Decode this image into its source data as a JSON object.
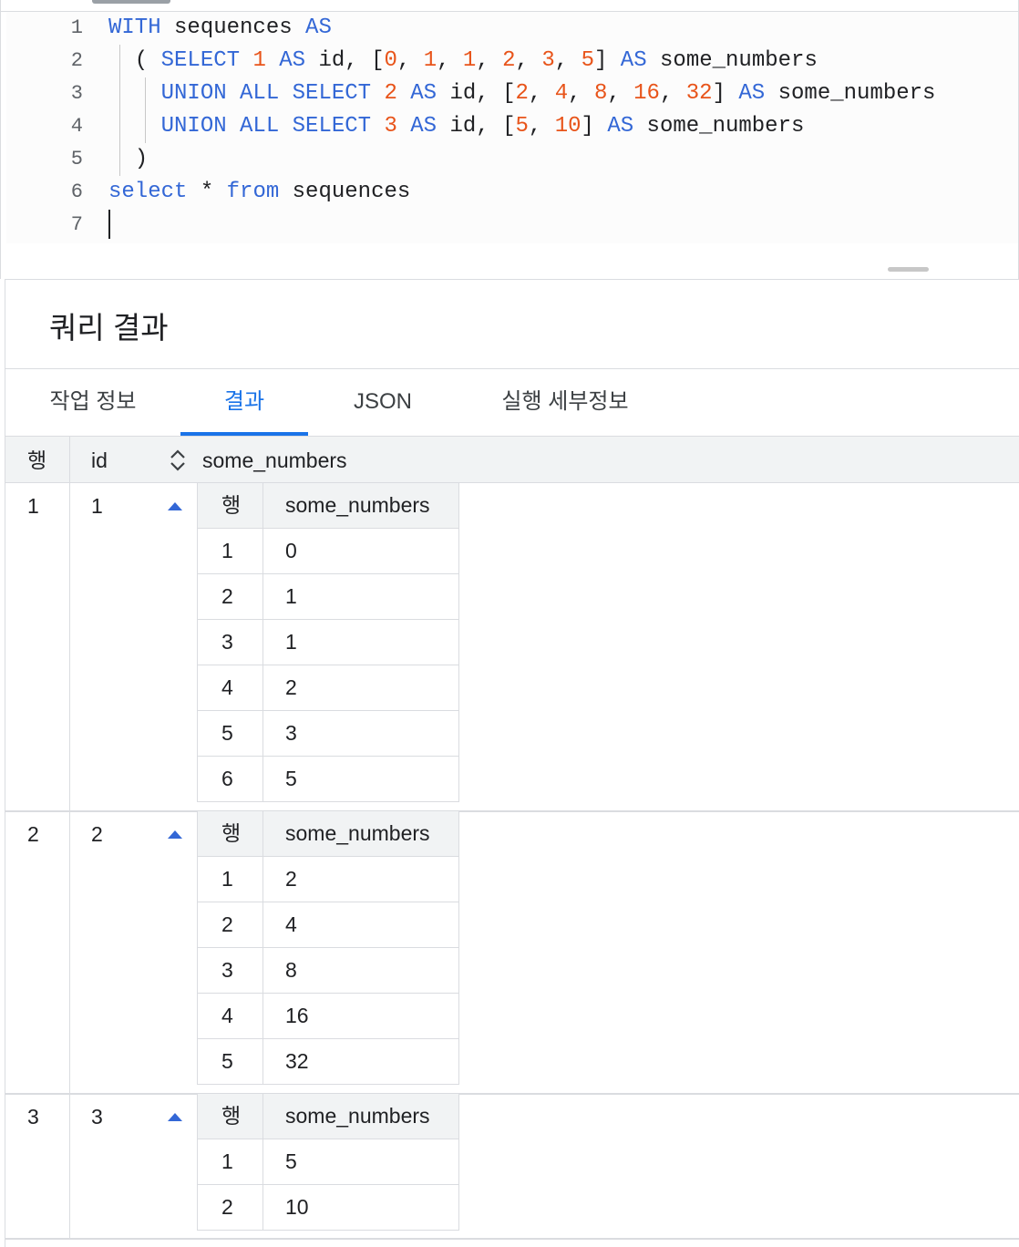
{
  "editor": {
    "lines": [
      {
        "n": "1",
        "tokens": [
          {
            "t": "WITH",
            "c": "kw"
          },
          {
            "t": " sequences ",
            "c": ""
          },
          {
            "t": "AS",
            "c": "kw"
          }
        ]
      },
      {
        "n": "2",
        "tokens": [
          {
            "t": "  ( ",
            "c": ""
          },
          {
            "t": "SELECT",
            "c": "kw"
          },
          {
            "t": " ",
            "c": ""
          },
          {
            "t": "1",
            "c": "num"
          },
          {
            "t": " ",
            "c": ""
          },
          {
            "t": "AS",
            "c": "kw"
          },
          {
            "t": " id, [",
            "c": ""
          },
          {
            "t": "0",
            "c": "num"
          },
          {
            "t": ", ",
            "c": ""
          },
          {
            "t": "1",
            "c": "num"
          },
          {
            "t": ", ",
            "c": ""
          },
          {
            "t": "1",
            "c": "num"
          },
          {
            "t": ", ",
            "c": ""
          },
          {
            "t": "2",
            "c": "num"
          },
          {
            "t": ", ",
            "c": ""
          },
          {
            "t": "3",
            "c": "num"
          },
          {
            "t": ", ",
            "c": ""
          },
          {
            "t": "5",
            "c": "num"
          },
          {
            "t": "] ",
            "c": ""
          },
          {
            "t": "AS",
            "c": "kw"
          },
          {
            "t": " some_numbers",
            "c": ""
          }
        ]
      },
      {
        "n": "3",
        "tokens": [
          {
            "t": "    ",
            "c": ""
          },
          {
            "t": "UNION ALL SELECT",
            "c": "kw"
          },
          {
            "t": " ",
            "c": ""
          },
          {
            "t": "2",
            "c": "num"
          },
          {
            "t": " ",
            "c": ""
          },
          {
            "t": "AS",
            "c": "kw"
          },
          {
            "t": " id, [",
            "c": ""
          },
          {
            "t": "2",
            "c": "num"
          },
          {
            "t": ", ",
            "c": ""
          },
          {
            "t": "4",
            "c": "num"
          },
          {
            "t": ", ",
            "c": ""
          },
          {
            "t": "8",
            "c": "num"
          },
          {
            "t": ", ",
            "c": ""
          },
          {
            "t": "16",
            "c": "num"
          },
          {
            "t": ", ",
            "c": ""
          },
          {
            "t": "32",
            "c": "num"
          },
          {
            "t": "] ",
            "c": ""
          },
          {
            "t": "AS",
            "c": "kw"
          },
          {
            "t": " some_numbers",
            "c": ""
          }
        ]
      },
      {
        "n": "4",
        "tokens": [
          {
            "t": "    ",
            "c": ""
          },
          {
            "t": "UNION ALL SELECT",
            "c": "kw"
          },
          {
            "t": " ",
            "c": ""
          },
          {
            "t": "3",
            "c": "num"
          },
          {
            "t": " ",
            "c": ""
          },
          {
            "t": "AS",
            "c": "kw"
          },
          {
            "t": " id, [",
            "c": ""
          },
          {
            "t": "5",
            "c": "num"
          },
          {
            "t": ", ",
            "c": ""
          },
          {
            "t": "10",
            "c": "num"
          },
          {
            "t": "] ",
            "c": ""
          },
          {
            "t": "AS",
            "c": "kw"
          },
          {
            "t": " some_numbers",
            "c": ""
          }
        ]
      },
      {
        "n": "5",
        "tokens": [
          {
            "t": "  )",
            "c": ""
          }
        ]
      },
      {
        "n": "6",
        "tokens": [
          {
            "t": "select",
            "c": "kw"
          },
          {
            "t": " * ",
            "c": ""
          },
          {
            "t": "from",
            "c": "kw"
          },
          {
            "t": " sequences",
            "c": ""
          }
        ]
      },
      {
        "n": "7",
        "tokens": []
      }
    ]
  },
  "results": {
    "title": "쿼리 결과",
    "tabs": [
      "작업 정보",
      "결과",
      "JSON",
      "실행 세부정보"
    ],
    "active_tab": "결과",
    "columns": {
      "row": "행",
      "id": "id",
      "some_numbers": "some_numbers"
    },
    "nested_columns": {
      "row": "행",
      "value": "some_numbers"
    },
    "rows": [
      {
        "row": "1",
        "id": "1",
        "items": [
          [
            "1",
            "0"
          ],
          [
            "2",
            "1"
          ],
          [
            "3",
            "1"
          ],
          [
            "4",
            "2"
          ],
          [
            "5",
            "3"
          ],
          [
            "6",
            "5"
          ]
        ]
      },
      {
        "row": "2",
        "id": "2",
        "items": [
          [
            "1",
            "2"
          ],
          [
            "2",
            "4"
          ],
          [
            "3",
            "8"
          ],
          [
            "4",
            "16"
          ],
          [
            "5",
            "32"
          ]
        ]
      },
      {
        "row": "3",
        "id": "3",
        "items": [
          [
            "1",
            "5"
          ],
          [
            "2",
            "10"
          ]
        ]
      }
    ]
  },
  "colors": {
    "keyword": "#3367d6",
    "number": "#e8541a",
    "accent": "#1a73e8"
  }
}
